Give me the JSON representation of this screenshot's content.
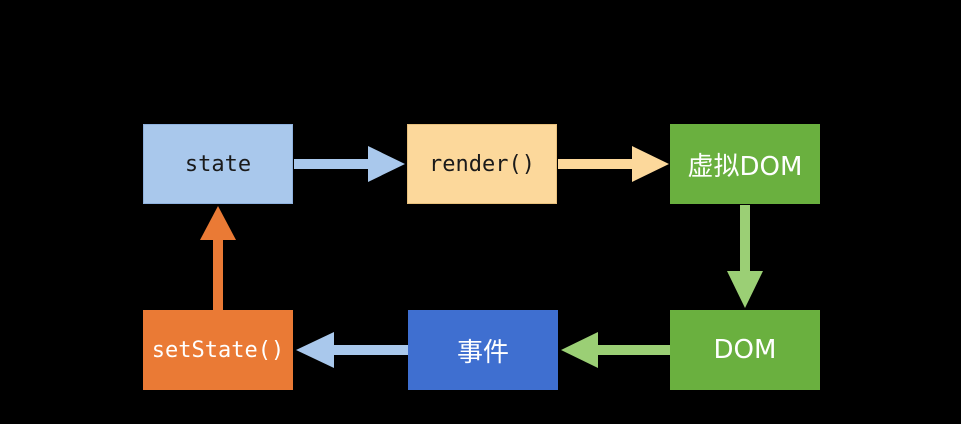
{
  "diagram": {
    "nodes": {
      "state": {
        "label": "state",
        "color": "#a9c8ec"
      },
      "render": {
        "label": "render()",
        "color": "#fcd89b"
      },
      "virtual_dom": {
        "label": "虚拟DOM",
        "color": "#6ab03f"
      },
      "dom": {
        "label": "DOM",
        "color": "#6ab03f"
      },
      "event": {
        "label": "事件",
        "color": "#3f6fd0"
      },
      "set_state": {
        "label": "setState()",
        "color": "#ea7a35"
      }
    },
    "edges": [
      {
        "from": "state",
        "to": "render",
        "color": "#a9c8ec"
      },
      {
        "from": "render",
        "to": "virtual_dom",
        "color": "#fcd89b"
      },
      {
        "from": "virtual_dom",
        "to": "dom",
        "color": "#9bcf75"
      },
      {
        "from": "dom",
        "to": "event",
        "color": "#9bcf75"
      },
      {
        "from": "event",
        "to": "set_state",
        "color": "#a9c8ec"
      },
      {
        "from": "set_state",
        "to": "state",
        "color": "#ea7a35"
      }
    ]
  }
}
